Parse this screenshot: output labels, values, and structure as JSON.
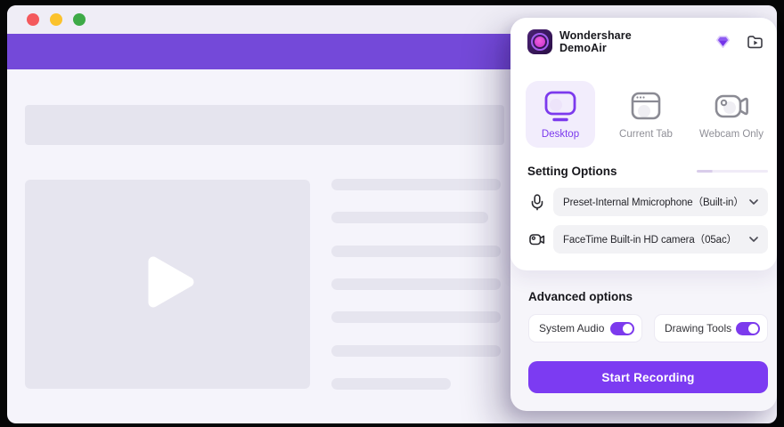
{
  "app": {
    "title_line1": "Wondershare",
    "title_line2": "DemoAir"
  },
  "window": {
    "traffic_lights": [
      "close",
      "minimize",
      "zoom"
    ]
  },
  "header_icons": {
    "premium_gem": "gem-icon",
    "recordings_library": "folder-play-icon"
  },
  "modes": [
    {
      "label": "Desktop",
      "selected": true
    },
    {
      "label": "Current Tab",
      "selected": false
    },
    {
      "label": "Webcam Only",
      "selected": false
    }
  ],
  "settings": {
    "heading": "Setting Options",
    "microphone": "Preset-Internal Mmicrophone（Built-in）",
    "camera": "FaceTime Built-in HD camera（05ac）"
  },
  "advanced": {
    "heading": "Advanced options",
    "toggles": [
      {
        "label": "System Audio",
        "on": true
      },
      {
        "label": "Drawing Tools",
        "on": true
      }
    ]
  },
  "actions": {
    "start_recording": "Start Recording"
  },
  "colors": {
    "accent": "#7c3aed",
    "start_button": "#7c3bf2",
    "page_header_bar": "#7449d9",
    "traffic_red": "#f4595d",
    "traffic_yellow": "#fbc22d",
    "traffic_green": "#3eaa47",
    "placeholder": "#e6e5ef"
  }
}
